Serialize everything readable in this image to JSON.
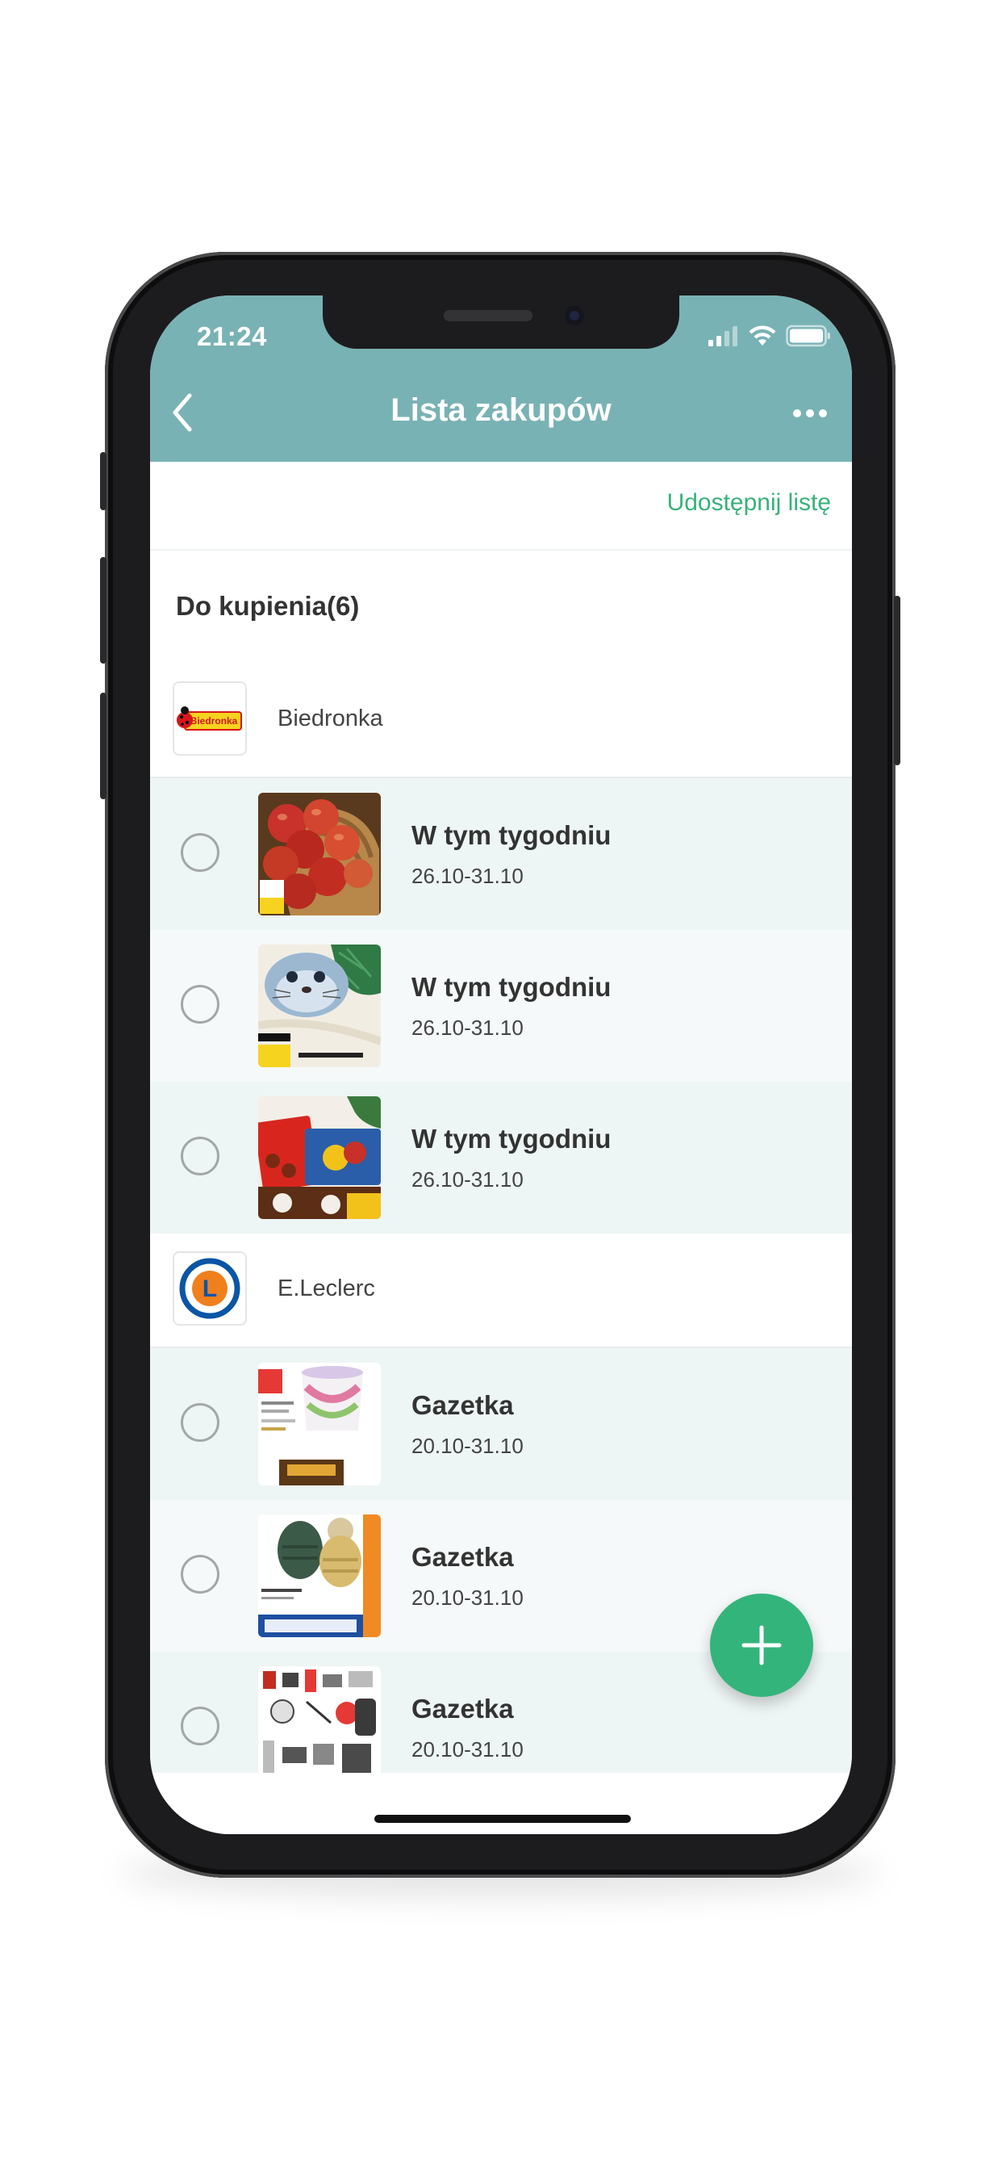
{
  "status_bar": {
    "time": "21:24"
  },
  "nav": {
    "title": "Lista zakupów",
    "back_icon": "chevron-left-icon",
    "more_icon": "more-horizontal-icon"
  },
  "share": {
    "label": "Udostępnij listę"
  },
  "section": {
    "title": "Do kupienia(6)"
  },
  "groups": [
    {
      "store": "Biedronka",
      "logo_text": "Biedronka",
      "items": [
        {
          "title": "W tym tygodniu",
          "date": "26.10-31.10",
          "thumb": "apples"
        },
        {
          "title": "W tym tygodniu",
          "date": "26.10-31.10",
          "thumb": "seal-toy"
        },
        {
          "title": "W tym tygodniu",
          "date": "26.10-31.10",
          "thumb": "candy"
        }
      ]
    },
    {
      "store": "E.Leclerc",
      "logo_text": "L",
      "items": [
        {
          "title": "Gazetka",
          "date": "20.10-31.10",
          "thumb": "ice-cream-leaflet"
        },
        {
          "title": "Gazetka",
          "date": "20.10-31.10",
          "thumb": "hats-leaflet"
        },
        {
          "title": "Gazetka",
          "date": "20.10-31.10",
          "thumb": "products-leaflet"
        }
      ]
    }
  ],
  "fab": {
    "icon": "plus-icon"
  },
  "colors": {
    "header": "#79b2b4",
    "accent": "#38b27a",
    "fab": "#33b47b",
    "row_dark": "#eef5f5",
    "row_light": "#f5f9f9"
  }
}
